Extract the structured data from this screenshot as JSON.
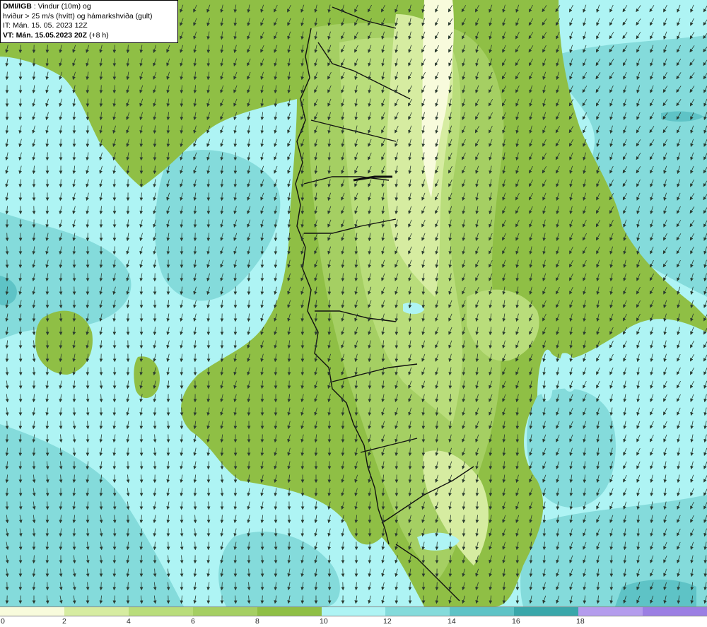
{
  "info": {
    "source": "DMI/IGB",
    "title_rest": " : Vindur (10m) og",
    "line2": "hviður > 25 m/s (hvítt) og hámarkshviða (gult)",
    "issue_time": "IT: Mán. 15. 05. 2023 12Z",
    "valid_prefix": "VT: Mán. 15.05.2023 20Z",
    "valid_suffix": " (+8 h)"
  },
  "legend": {
    "colors": [
      "#f8fbdc",
      "#d6eca1",
      "#b9dd7b",
      "#a5cf63",
      "#8fbf45",
      "#aef4f4",
      "#84dbdb",
      "#5ec3c6",
      "#3aa7aa",
      "#b49ced",
      "#9b7fe3"
    ],
    "labels": [
      "0",
      "2",
      "4",
      "6",
      "8",
      "10",
      "12",
      "14",
      "16",
      "18"
    ]
  },
  "map": {
    "land_color": "#8fbf45",
    "sea_color": "#aef4f4",
    "strong_wind_color": "#84dbdb",
    "coastline_color": "#111111",
    "arrow_color": "#2a3a30"
  }
}
